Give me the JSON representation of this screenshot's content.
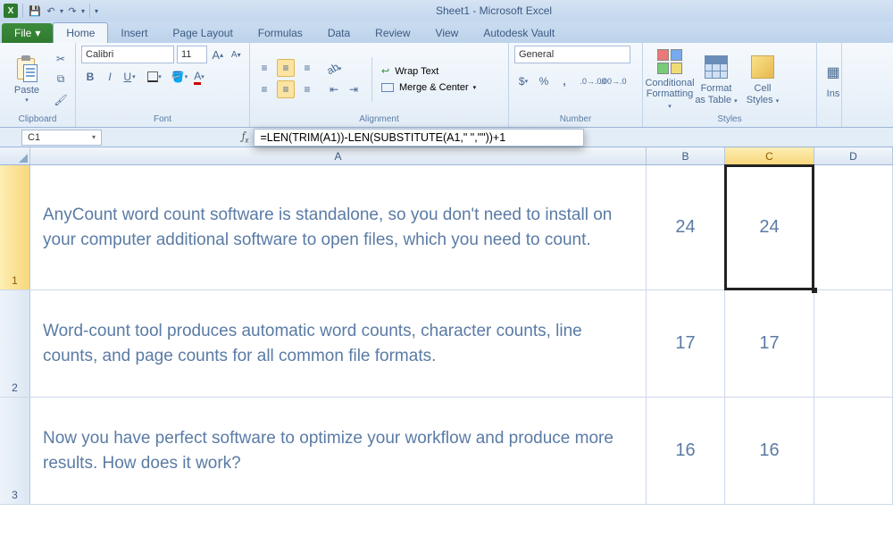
{
  "window": {
    "title": "Sheet1 - Microsoft Excel"
  },
  "tabs": {
    "file": "File",
    "home": "Home",
    "insert": "Insert",
    "pagelayout": "Page Layout",
    "formulas": "Formulas",
    "data": "Data",
    "review": "Review",
    "view": "View",
    "vault": "Autodesk Vault"
  },
  "clipboard": {
    "paste": "Paste",
    "label": "Clipboard"
  },
  "font": {
    "family": "Calibri",
    "size": "11",
    "label": "Font"
  },
  "alignment": {
    "wrap": "Wrap Text",
    "merge": "Merge & Center",
    "label": "Alignment"
  },
  "number": {
    "format": "General",
    "label": "Number"
  },
  "styles": {
    "cond": "Conditional Formatting",
    "table": "Format as Table",
    "cell": "Cell Styles",
    "label": "Styles"
  },
  "insert_lbl": "Ins",
  "namebox": "C1",
  "formula": "=LEN(TRIM(A1))-LEN(SUBSTITUTE(A1,\" \",\"\"))+1",
  "columns": [
    "A",
    "B",
    "C",
    "D"
  ],
  "rows": [
    {
      "n": "1",
      "a": "AnyCount word count software is standalone, so you don't need to install on your computer additional software to open files, which you need to count.",
      "b": "24",
      "c": "24"
    },
    {
      "n": "2",
      "a": "Word-count tool produces automatic word counts, character counts, line counts, and page counts for all common file formats.",
      "b": "17",
      "c": "17"
    },
    {
      "n": "3",
      "a": "Now you have perfect software to optimize your workflow and produce more results. How does it work?",
      "b": "16",
      "c": "16"
    }
  ],
  "chart_data": {
    "type": "table",
    "columns": [
      "A (text)",
      "B (word count)",
      "C (formula word count)"
    ],
    "rows": [
      [
        "AnyCount word count software is standalone, so you don't need to install on your computer additional software to open files, which you need to count.",
        24,
        24
      ],
      [
        "Word-count tool produces automatic word counts, character counts, line counts, and page counts for all common file formats.",
        17,
        17
      ],
      [
        "Now you have perfect software to optimize your workflow and produce more results. How does it work?",
        16,
        16
      ]
    ],
    "selected_cell": "C1",
    "formula_bar": "=LEN(TRIM(A1))-LEN(SUBSTITUTE(A1,\" \",\"\"))+1"
  }
}
